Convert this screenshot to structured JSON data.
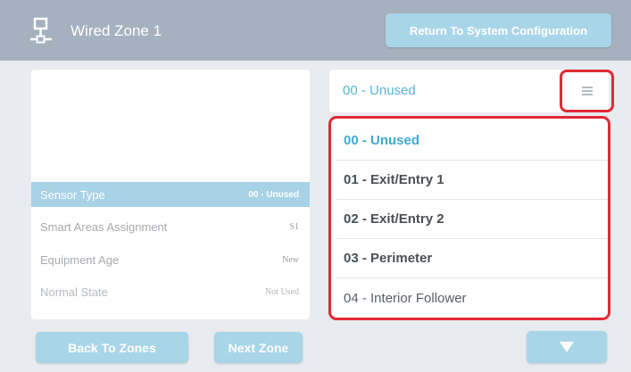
{
  "header": {
    "title": "Wired Zone 1",
    "return_button": "Return To System Configuration",
    "icon": "network-zone-icon"
  },
  "properties": [
    {
      "label": "Sensor Type",
      "value": "00 - Unused",
      "active": true
    },
    {
      "label": "Smart Areas Assignment",
      "value": "S1"
    },
    {
      "label": "Equipment Age",
      "value": "New"
    },
    {
      "label": "Normal State",
      "value": "Not Used"
    }
  ],
  "sensor_select": {
    "value": "00 - Unused",
    "menu_icon": "hamburger-menu-icon"
  },
  "dropdown_options": [
    "00 - Unused",
    "01 - Exit/Entry 1",
    "02 - Exit/Entry 2",
    "03 - Perimeter",
    "04 - Interior Follower"
  ],
  "footer": {
    "back_button": "Back To Zones",
    "next_button": "Next Zone",
    "scroll_down_icon": "triangle-down-icon"
  },
  "colors": {
    "header_bg": "#a6b1bf",
    "accent": "#a9d5e8",
    "selected_text": "#3fa9d2",
    "highlight_border": "#e02a35"
  }
}
